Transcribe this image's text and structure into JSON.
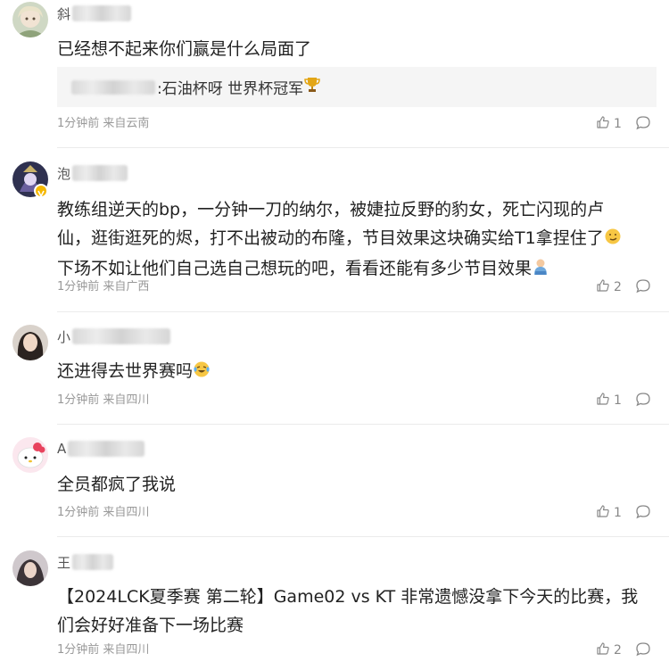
{
  "comments": [
    {
      "name_initial": "斜",
      "text": "已经想不起来你们赢是什么局面了",
      "reply": {
        "text": ":石油杯呀 世界杯冠军",
        "emoji": "trophy-emoji"
      },
      "meta": "1分钟前 来自云南",
      "likes": "1"
    },
    {
      "name_initial": "泡",
      "text_lines": [
        "教练组逆天的bp，一分钟一刀的纳尔，被婕拉反野的豹女，死亡闪现的卢",
        "仙，逛街逛死的烬，打不出被动的布隆，节目效果这块确实给T1拿捏住了",
        "下场不如让他们自己选自己想玩的吧，看看还能有多少节目效果"
      ],
      "meta": "1分钟前 来自广西",
      "likes": "2"
    },
    {
      "name_initial": "小",
      "text": "还进得去世界赛吗",
      "meta": "1分钟前 来自四川",
      "likes": "1"
    },
    {
      "name_initial": "A",
      "text": "全员都疯了我说",
      "meta": "1分钟前 来自四川",
      "likes": "1"
    },
    {
      "name_initial": "王",
      "text_lines": [
        "【2024LCK夏季赛 第二轮】Game02 vs KT 非常遗憾没拿下今天的比赛，我",
        "们会好好准备下一场比赛"
      ],
      "meta": "1分钟前 来自四川",
      "likes": "2"
    }
  ],
  "icons": {
    "like": "thumbs-up-icon",
    "reply": "comment-bubble-icon"
  },
  "colors": {
    "meta": "#999999",
    "reply_bg": "#f5f5f5",
    "divider": "#ebebeb"
  }
}
